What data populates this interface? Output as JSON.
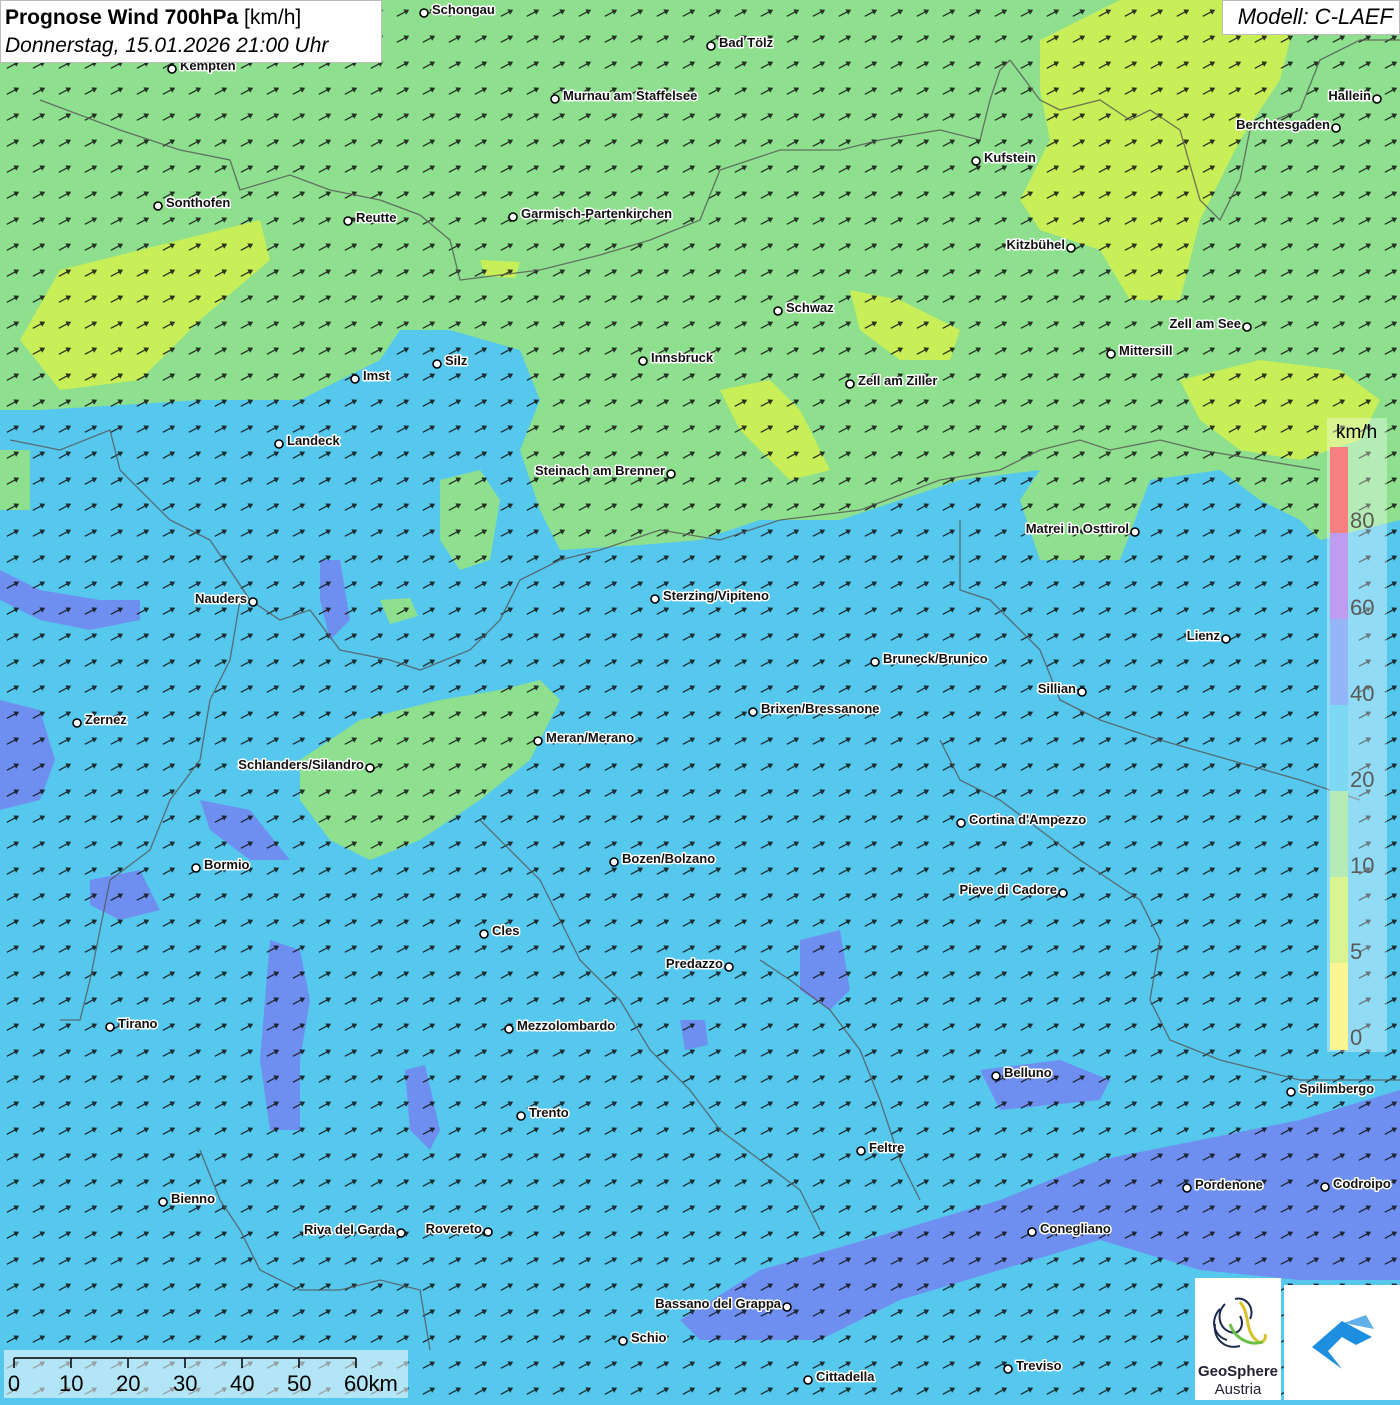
{
  "header": {
    "title_bold": "Prognose Wind 700hPa",
    "title_unit": "[km/h]",
    "datetime": "Donnerstag, 15.01.2026 21:00 Uhr",
    "model": "Modell: C-LAEF"
  },
  "legend": {
    "unit": "km/h",
    "classes": [
      {
        "from": 0,
        "to": 5,
        "color": "#fbf05a"
      },
      {
        "from": 5,
        "to": 10,
        "color": "#c8ee58"
      },
      {
        "from": 10,
        "to": 20,
        "color": "#8ee08e"
      },
      {
        "from": 20,
        "to": 40,
        "color": "#38c4ee"
      },
      {
        "from": 40,
        "to": 60,
        "color": "#5b8ff2"
      },
      {
        "from": 60,
        "to": 80,
        "color": "#9b69ea"
      },
      {
        "from": 80,
        "to": 100,
        "color": "#f23c3c"
      }
    ],
    "tick_labels": [
      "0",
      "5",
      "10",
      "20",
      "40",
      "60",
      "80"
    ]
  },
  "scale_bar": {
    "labels": [
      "0",
      "10",
      "20",
      "30",
      "40",
      "50",
      "60km"
    ]
  },
  "wind": {
    "dominant_direction": "south-west to north-east"
  },
  "cities": [
    {
      "name": "Schongau"
    },
    {
      "name": "Bad Tölz"
    },
    {
      "name": "Kempten"
    },
    {
      "name": "Murnau am Staffelsee"
    },
    {
      "name": "Hallein"
    },
    {
      "name": "Berchtesgaden"
    },
    {
      "name": "Kufstein"
    },
    {
      "name": "Sonthofen"
    },
    {
      "name": "Reutte"
    },
    {
      "name": "Garmisch-Partenkirchen"
    },
    {
      "name": "Kitzbühel"
    },
    {
      "name": "Schwaz"
    },
    {
      "name": "Zell am See"
    },
    {
      "name": "Mittersill"
    },
    {
      "name": "Innsbruck"
    },
    {
      "name": "Silz"
    },
    {
      "name": "Imst"
    },
    {
      "name": "Zell am Ziller"
    },
    {
      "name": "Landeck"
    },
    {
      "name": "Steinach am Brenner"
    },
    {
      "name": "Matrei in Osttirol"
    },
    {
      "name": "Nauders"
    },
    {
      "name": "Sterzing/Vipiteno"
    },
    {
      "name": "Lienz"
    },
    {
      "name": "Bruneck/Brunico"
    },
    {
      "name": "Sillian"
    },
    {
      "name": "Zernez"
    },
    {
      "name": "Brixen/Bressanone"
    },
    {
      "name": "Meran/Merano"
    },
    {
      "name": "Schlanders/Silandro"
    },
    {
      "name": "Cortina d'Ampezzo"
    },
    {
      "name": "Bozen/Bolzano"
    },
    {
      "name": "Bormio"
    },
    {
      "name": "Pieve di Cadore"
    },
    {
      "name": "Cles"
    },
    {
      "name": "Predazzo"
    },
    {
      "name": "Tirano"
    },
    {
      "name": "Mezzolombardo"
    },
    {
      "name": "Belluno"
    },
    {
      "name": "Spilimbergo"
    },
    {
      "name": "Trento"
    },
    {
      "name": "Feltre"
    },
    {
      "name": "Pordenone"
    },
    {
      "name": "Codroipo"
    },
    {
      "name": "Bienno"
    },
    {
      "name": "Riva del Garda"
    },
    {
      "name": "Rovereto"
    },
    {
      "name": "Conegliano"
    },
    {
      "name": "Bassano del Grappa"
    },
    {
      "name": "Schio"
    },
    {
      "name": "Treviso"
    },
    {
      "name": "Cittadella"
    }
  ],
  "logos": {
    "geosphere_name": "GeoSphere",
    "geosphere_sub": "Austria",
    "brand_color": "#1e8fe0"
  }
}
